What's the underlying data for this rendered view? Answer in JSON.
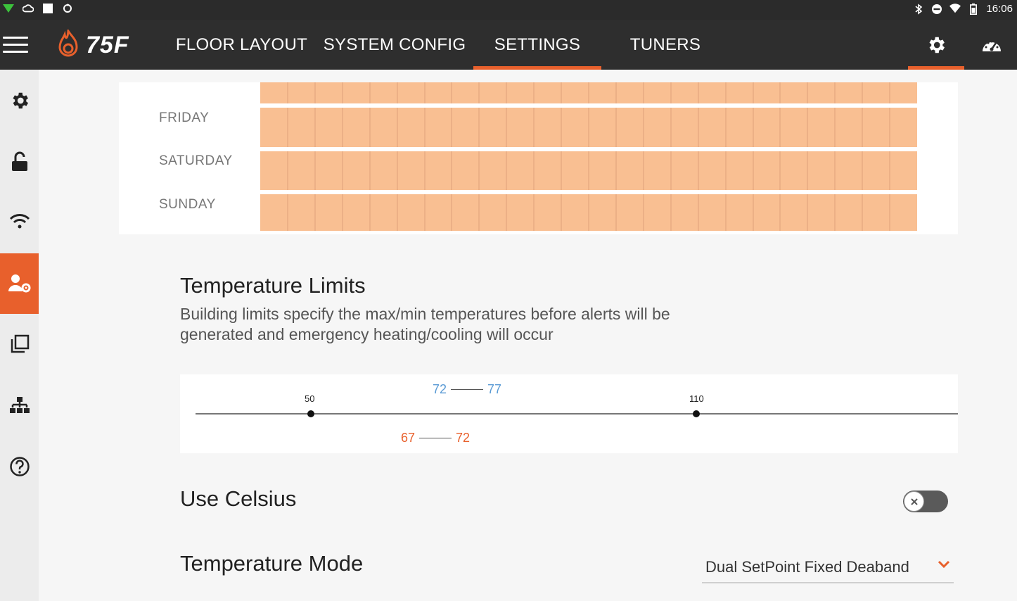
{
  "status_bar": {
    "time": "16:06",
    "left_icons": [
      "signal-icon",
      "cloud-icon",
      "square-icon",
      "sync-icon"
    ],
    "right_icons": [
      "bluetooth-icon",
      "dnd-icon",
      "wifi-icon",
      "battery-icon"
    ]
  },
  "app_bar": {
    "logo_text": "75F",
    "tabs": [
      {
        "label": "FLOOR LAYOUT"
      },
      {
        "label": "SYSTEM CONFIG"
      },
      {
        "label": "SETTINGS",
        "active": true
      },
      {
        "label": "TUNERS"
      }
    ],
    "right_icons": [
      "settings-gear-icon",
      "dashboard-gauge-icon"
    ]
  },
  "sidebar": {
    "items": [
      {
        "icon": "settings-gear-icon"
      },
      {
        "icon": "unlock-icon"
      },
      {
        "icon": "wifi-icon"
      },
      {
        "icon": "user-settings-icon",
        "active": true
      },
      {
        "icon": "copy-icon"
      },
      {
        "icon": "network-icon"
      },
      {
        "icon": "help-icon"
      }
    ]
  },
  "schedule": {
    "days": [
      "FRIDAY",
      "SATURDAY",
      "SUNDAY"
    ]
  },
  "temperature_limits": {
    "title": "Temperature Limits",
    "description": "Building limits specify the max/min temperatures before alerts will be generated and emergency heating/cooling will occur",
    "building_min": "50",
    "building_max": "110",
    "cooling_range": {
      "low": "72",
      "high": "77"
    },
    "heating_range": {
      "low": "67",
      "high": "72"
    }
  },
  "use_celsius": {
    "label": "Use Celsius",
    "enabled": false
  },
  "temperature_mode": {
    "label": "Temperature Mode",
    "value": "Dual SetPoint Fixed Deaband"
  },
  "colors": {
    "accent": "#e8602c",
    "schedule_fill": "#f9bf92",
    "cooling": "#5b9bd5",
    "heating": "#e8602c"
  }
}
